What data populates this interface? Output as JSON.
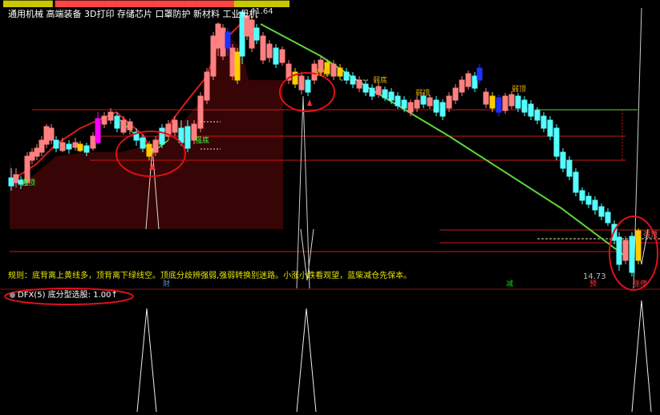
{
  "header": {
    "sectors": "通用机械 高端装备 3D打印 存储芯片 口罩防护 新材料 工业母机",
    "price_high": "41.64"
  },
  "rule_text": "规则：底背离上黄线多，顶背离下绿线空。顶底分歧辨强弱,强弱转换别迷路。小涨小跌看观望，蓝柴减仓先保本。",
  "price_low": "14.73",
  "bottom_labels": {
    "cai": "财",
    "jian": "减",
    "yu": "预",
    "zhang": "涨停"
  },
  "chart_stamps": {
    "weak_bottom": "弱底",
    "weak_top": "弱顶",
    "strong_bottom": "强底",
    "strong_top": "强顶",
    "left_strong": "强顶"
  },
  "indicator": {
    "name": "DFX(5)",
    "label": "底分型选股:",
    "value": "1.00",
    "arrow": "↑"
  },
  "colors": {
    "up_candle": "#ff8080",
    "down_candle": "#54ffff",
    "yellow_candle": "#ffcc00",
    "blue_candle": "#2030ff",
    "magenta_candle": "#ff00ff",
    "trend_green": "#5cd63c",
    "trend_red": "#d41c1c",
    "fill": "#3a0505",
    "circle": "#e0101a"
  }
}
